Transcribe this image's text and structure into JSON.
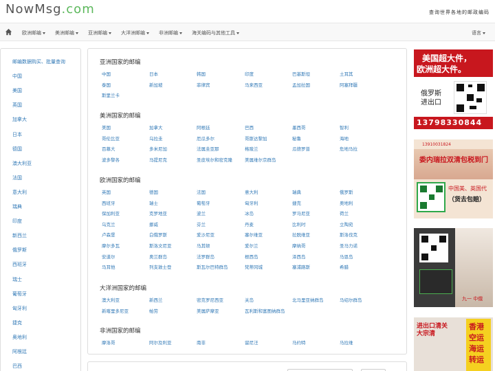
{
  "header": {
    "logo_main": "NowMsg",
    "logo_dot": ".",
    "logo_tld": "com",
    "slogan": "查询世界各地的邮政编码"
  },
  "navbar": {
    "home_icon": "home-icon",
    "items": [
      "欧洲邮编",
      "美洲邮编",
      "亚洲邮编",
      "大洋洲邮编",
      "非洲邮编",
      "海关编码与其他工具"
    ],
    "language": "语言"
  },
  "sidebar": {
    "items": [
      "邮编数据购买、批量查询",
      "中国",
      "美国",
      "英国",
      "加拿大",
      "日本",
      "德国",
      "澳大利亚",
      "法国",
      "意大利",
      "瑞典",
      "印度",
      "新西兰",
      "俄罗斯",
      "西班牙",
      "瑞士",
      "葡萄牙",
      "匈牙利",
      "捷克",
      "奥地利",
      "阿根廷",
      "巴西"
    ]
  },
  "sections": [
    {
      "title": "亚洲国家的邮编",
      "rows": [
        [
          "中国",
          "日本",
          "韩国",
          "印度",
          "巴基斯坦",
          "土耳其"
        ],
        [
          "泰国",
          "新加坡",
          "菲律宾",
          "马来西亚",
          "孟加拉国",
          "阿塞拜疆"
        ],
        [
          "斯里兰卡"
        ]
      ]
    },
    {
      "title": "美洲国家的邮编",
      "rows": [
        [
          "美国",
          "加拿大",
          "阿根廷",
          "巴西",
          "墨西哥",
          "智利"
        ],
        [
          "哥伦比亚",
          "乌拉圭",
          "厄瓜多尔",
          "哥斯达黎加",
          "秘鲁",
          "海地"
        ],
        [
          "百慕大",
          "多米尼加",
          "法属圭亚那",
          "格陵兰",
          "瓜德罗普",
          "危地马拉"
        ],
        [
          "波多黎各",
          "马提尼克",
          "圣皮埃尔和密克隆",
          "美属维尔京群岛"
        ]
      ]
    },
    {
      "title": "欧洲国家的邮编",
      "rows": [
        [
          "英国",
          "德国",
          "法国",
          "意大利",
          "瑞典",
          "俄罗斯"
        ],
        [
          "西班牙",
          "瑞士",
          "葡萄牙",
          "匈牙利",
          "捷克",
          "奥地利"
        ],
        [
          "保加利亚",
          "克罗地亚",
          "波兰",
          "冰岛",
          "罗马尼亚",
          "荷兰"
        ],
        [
          "乌克兰",
          "挪威",
          "芬兰",
          "丹麦",
          "比利时",
          "立陶宛"
        ],
        [
          "卢森堡",
          "白俄罗斯",
          "爱沙尼亚",
          "塞尔维亚",
          "拉脱维亚",
          "斯洛伐克"
        ],
        [
          "摩尔多瓦",
          "斯洛文尼亚",
          "马其顿",
          "爱尔兰",
          "摩纳哥",
          "圣马力诺"
        ],
        [
          "安道尔",
          "奥兰群岛",
          "法罗群岛",
          "根西岛",
          "泽西岛",
          "马恩岛"
        ],
        [
          "马耳他",
          "列支敦士登",
          "斯瓦尔巴特群岛",
          "梵蒂冈城",
          "塞浦路斯",
          "希腊"
        ]
      ]
    },
    {
      "title": "大洋洲国家的邮编",
      "rows": [
        [
          "澳大利亚",
          "新西兰",
          "密克罗尼西亚",
          "关岛",
          "北马里亚纳群岛",
          "马绍尔群岛"
        ],
        [
          "新喀里多尼亚",
          "帕劳",
          "美属萨摩亚",
          "瓦利斯和富图纳群岛"
        ]
      ]
    },
    {
      "title": "非洲国家的邮编",
      "rows": [
        [
          "摩洛哥",
          "阿尔及利亚",
          "南非",
          "留尼汪",
          "马约特",
          "马拉维"
        ]
      ]
    }
  ],
  "ads": {
    "ad1_line1": "美国超大件，",
    "ad1_line2": "欧洲超大件。",
    "ad1_side": "俄罗斯进出口",
    "ad1_phone": "13798330844",
    "ad2_phone": "13910031824",
    "ad2_line": "委内瑞拉双清包税到门",
    "ad2_box1": "中国美、英国代",
    "ad2_box2": "（货去包赔）",
    "ad3_line": "九一 中俄",
    "ad4_left": "进出口清关大宗清",
    "ad4_right": "香港空运海运转运"
  },
  "colors": {
    "link": "#337ab7",
    "logo_accent": "#5cb85c",
    "ad_red": "#c8171e"
  }
}
